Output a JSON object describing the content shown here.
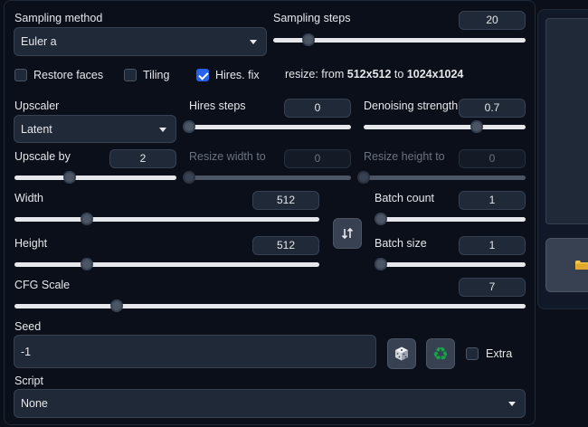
{
  "sampling": {
    "method_label": "Sampling method",
    "method_value": "Euler a",
    "steps_label": "Sampling steps",
    "steps_value": "20",
    "steps_fraction": 0.138
  },
  "checks": {
    "restore_faces": "Restore faces",
    "tiling": "Tiling",
    "hires_fix": "Hires. fix",
    "restore_faces_checked": false,
    "tiling_checked": false,
    "hires_fix_checked": true
  },
  "resize_info": {
    "prefix": "resize: from ",
    "from": "512x512",
    "to_word": " to ",
    "to": "1024x1024"
  },
  "hires": {
    "upscaler_label": "Upscaler",
    "upscaler_value": "Latent",
    "steps_label": "Hires steps",
    "steps_value": "0",
    "steps_fraction": 0.0,
    "denoise_label": "Denoising strength",
    "denoise_value": "0.7",
    "denoise_fraction": 0.7,
    "upscale_by_label": "Upscale by",
    "upscale_by_value": "2",
    "upscale_by_fraction": 0.34,
    "resize_w_label": "Resize width to",
    "resize_w_value": "0",
    "resize_h_label": "Resize height to",
    "resize_h_value": "0"
  },
  "dims": {
    "width_label": "Width",
    "width_value": "512",
    "width_fraction": 0.236,
    "height_label": "Height",
    "height_value": "512",
    "height_fraction": 0.236,
    "batch_count_label": "Batch count",
    "batch_count_value": "1",
    "batch_count_fraction": 0.0,
    "batch_size_label": "Batch size",
    "batch_size_value": "1",
    "batch_size_fraction": 0.0
  },
  "cfg": {
    "label": "CFG Scale",
    "value": "7",
    "fraction": 0.2
  },
  "seed": {
    "label": "Seed",
    "value": "-1",
    "extra_label": "Extra",
    "extra_checked": false
  },
  "script": {
    "label": "Script",
    "value": "None"
  },
  "icons": {
    "swap": "swap-dimensions-icon",
    "dice": "dice-icon",
    "recycle": "recycle-icon",
    "folder": "folder-icon"
  },
  "colors": {
    "background": "#0b0f19",
    "input_bg": "#1f2937",
    "accent": "#2563eb",
    "recycle": "#16a34a"
  }
}
